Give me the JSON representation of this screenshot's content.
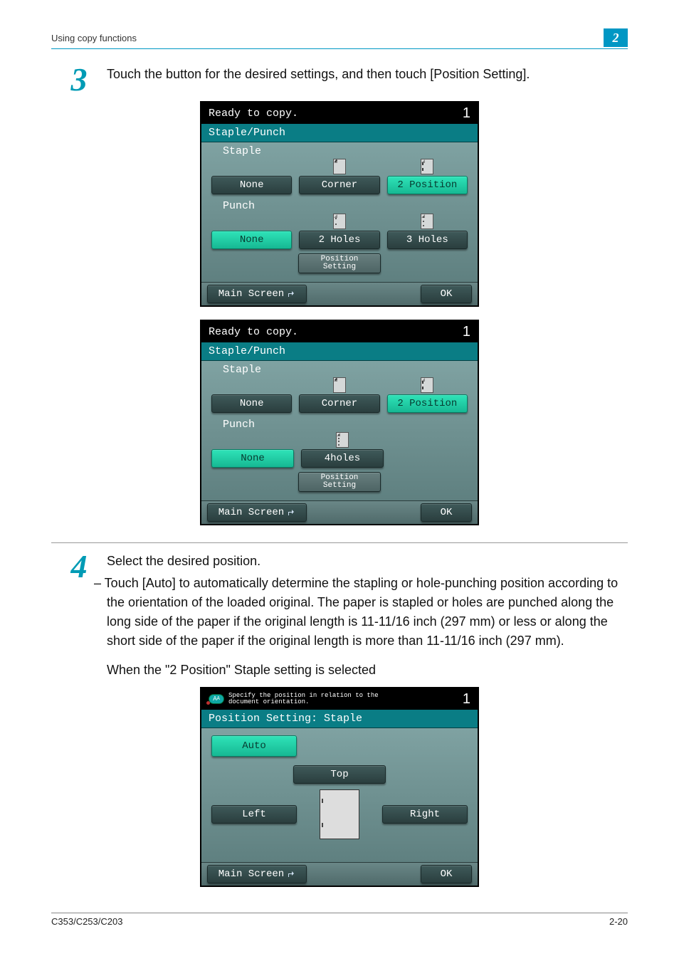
{
  "header": {
    "section": "Using copy functions",
    "chapter": "2"
  },
  "step3": {
    "num": "3",
    "text": "Touch the button for the desired settings, and then touch [Position Setting]."
  },
  "panelA": {
    "status": "Ready to copy.",
    "count": "1",
    "title": "Staple/Punch",
    "stapleLabel": "Staple",
    "staple": {
      "none": "None",
      "corner": "Corner",
      "pos2": "2 Position"
    },
    "punchLabel": "Punch",
    "punch": {
      "none": "None",
      "h2": "2 Holes",
      "h3": "3 Holes"
    },
    "posSetting": "Position\nSetting",
    "main": "Main Screen",
    "ok": "OK"
  },
  "panelB": {
    "status": "Ready to copy.",
    "count": "1",
    "title": "Staple/Punch",
    "stapleLabel": "Staple",
    "staple": {
      "none": "None",
      "corner": "Corner",
      "pos2": "2 Position"
    },
    "punchLabel": "Punch",
    "punch": {
      "none": "None",
      "h4": "4holes"
    },
    "posSetting": "Position\nSetting",
    "main": "Main Screen",
    "ok": "OK"
  },
  "step4": {
    "num": "4",
    "text": "Select the desired position.",
    "bullet": "– Touch [Auto] to automatically determine the stapling or hole-punching position according to the orientation of the loaded original. The paper is stapled or holes are punched along the long side of the paper if the original length is 11-11/16 inch (297 mm) or less or along the short side of the paper if the original length is more than 11-11/16 inch (297 mm).",
    "caption": "When the \"2 Position\" Staple setting is selected"
  },
  "panelC": {
    "status": "Specify the position in relation to the\ndocument orientation.",
    "count": "1",
    "title": "Position Setting: Staple",
    "auto": "Auto",
    "top": "Top",
    "left": "Left",
    "right": "Right",
    "main": "Main Screen",
    "ok": "OK"
  },
  "footer": {
    "model": "C353/C253/C203",
    "page": "2-20"
  }
}
